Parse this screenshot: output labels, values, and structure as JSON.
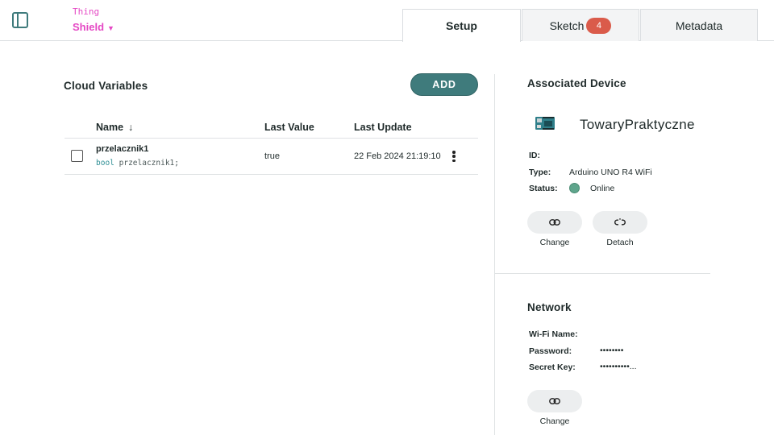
{
  "header": {
    "thing_label": "Thing",
    "thing_name": "Shield",
    "tabs": [
      {
        "label": "Setup",
        "active": true
      },
      {
        "label": "Sketch",
        "badge": "4"
      },
      {
        "label": "Metadata"
      }
    ]
  },
  "cloud_variables": {
    "title": "Cloud Variables",
    "add_label": "ADD",
    "columns": {
      "name": "Name",
      "last_value": "Last Value",
      "last_update": "Last Update"
    },
    "rows": [
      {
        "name": "przelacznik1",
        "type_keyword": "bool",
        "declaration": "przelacznik1;",
        "last_value": "true",
        "last_update": "22 Feb 2024 21:19:10"
      }
    ]
  },
  "associated_device": {
    "title": "Associated Device",
    "device_name": "TowaryPraktyczne",
    "id_label": "ID:",
    "id_value": "",
    "type_label": "Type:",
    "type_value": "Arduino UNO R4 WiFi",
    "status_label": "Status:",
    "status_value": "Online",
    "status_color": "#5fa58c",
    "change_label": "Change",
    "detach_label": "Detach"
  },
  "network": {
    "title": "Network",
    "wifi_label": "Wi-Fi Name:",
    "wifi_value": "",
    "password_label": "Password:",
    "password_value": "••••••••",
    "secret_label": "Secret Key:",
    "secret_value": "••••••••••...",
    "change_label": "Change"
  },
  "colors": {
    "accent": "#3f7b7c",
    "thing": "#e548c4",
    "badge": "#da5b4a"
  }
}
